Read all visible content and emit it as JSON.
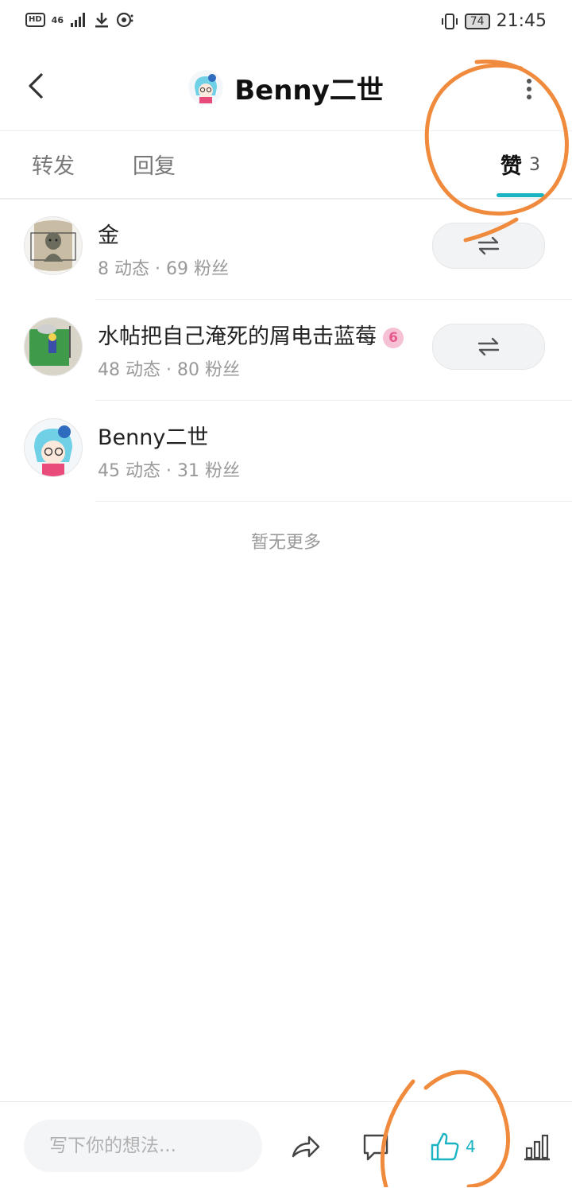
{
  "status_bar": {
    "hd": "HD",
    "network": "46",
    "battery": "74",
    "time": "21:45"
  },
  "header": {
    "title": "Benny二世"
  },
  "tabs": [
    {
      "label": "转发"
    },
    {
      "label": "回复"
    },
    {
      "label": "赞",
      "count": "3",
      "active": true
    }
  ],
  "likers": [
    {
      "name": "金",
      "meta": "8 动态 · 69 粉丝",
      "has_follow_button": true
    },
    {
      "name": "水帖把自己淹死的屑电击蓝莓",
      "badge": "6",
      "meta": "48 动态 · 80 粉丝",
      "has_follow_button": true
    },
    {
      "name": "Benny二世",
      "meta": "45 动态 · 31 粉丝",
      "has_follow_button": false
    }
  ],
  "list_footer": "暂无更多",
  "bottom_bar": {
    "input_placeholder": "写下你的想法...",
    "like_count": "4"
  },
  "colors": {
    "accent": "#19b3c2",
    "annotation": "#f08a3c"
  }
}
